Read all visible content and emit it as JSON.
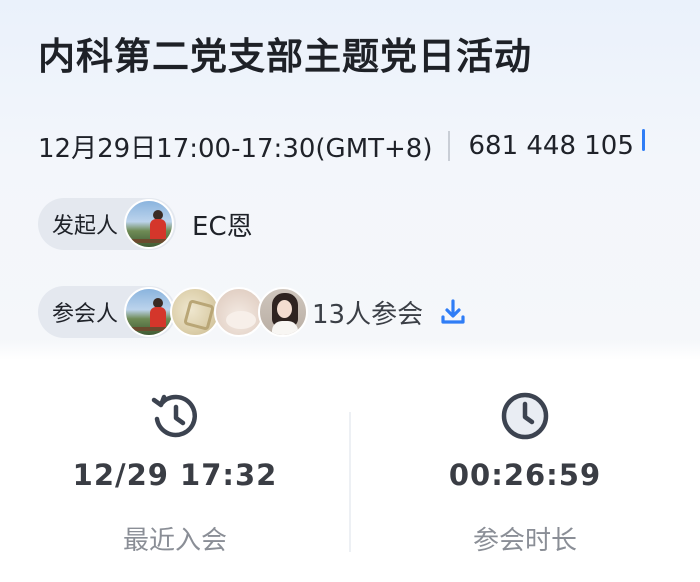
{
  "meeting": {
    "title": "内科第二党支部主题党日活动",
    "time_range": "12月29日17:00-17:30(GMT+8)",
    "meeting_id": "681 448 105"
  },
  "host": {
    "label": "发起人",
    "name": "EC恩"
  },
  "participants": {
    "label": "参会人",
    "count_text": "13人参会",
    "avatars": [
      "avatar-landscape-person",
      "avatar-stamp",
      "avatar-soft-pink",
      "avatar-woman-portrait"
    ]
  },
  "stats": {
    "last_join": {
      "value": "12/29 17:32",
      "caption": "最近入会",
      "icon": "history-icon"
    },
    "duration": {
      "value": "00:26:59",
      "caption": "参会时长",
      "icon": "clock-icon"
    }
  },
  "colors": {
    "accent": "#2f7df6",
    "icon": "#3c4350",
    "pill_bg": "#e4e8ef",
    "caption": "#8a8e96"
  }
}
